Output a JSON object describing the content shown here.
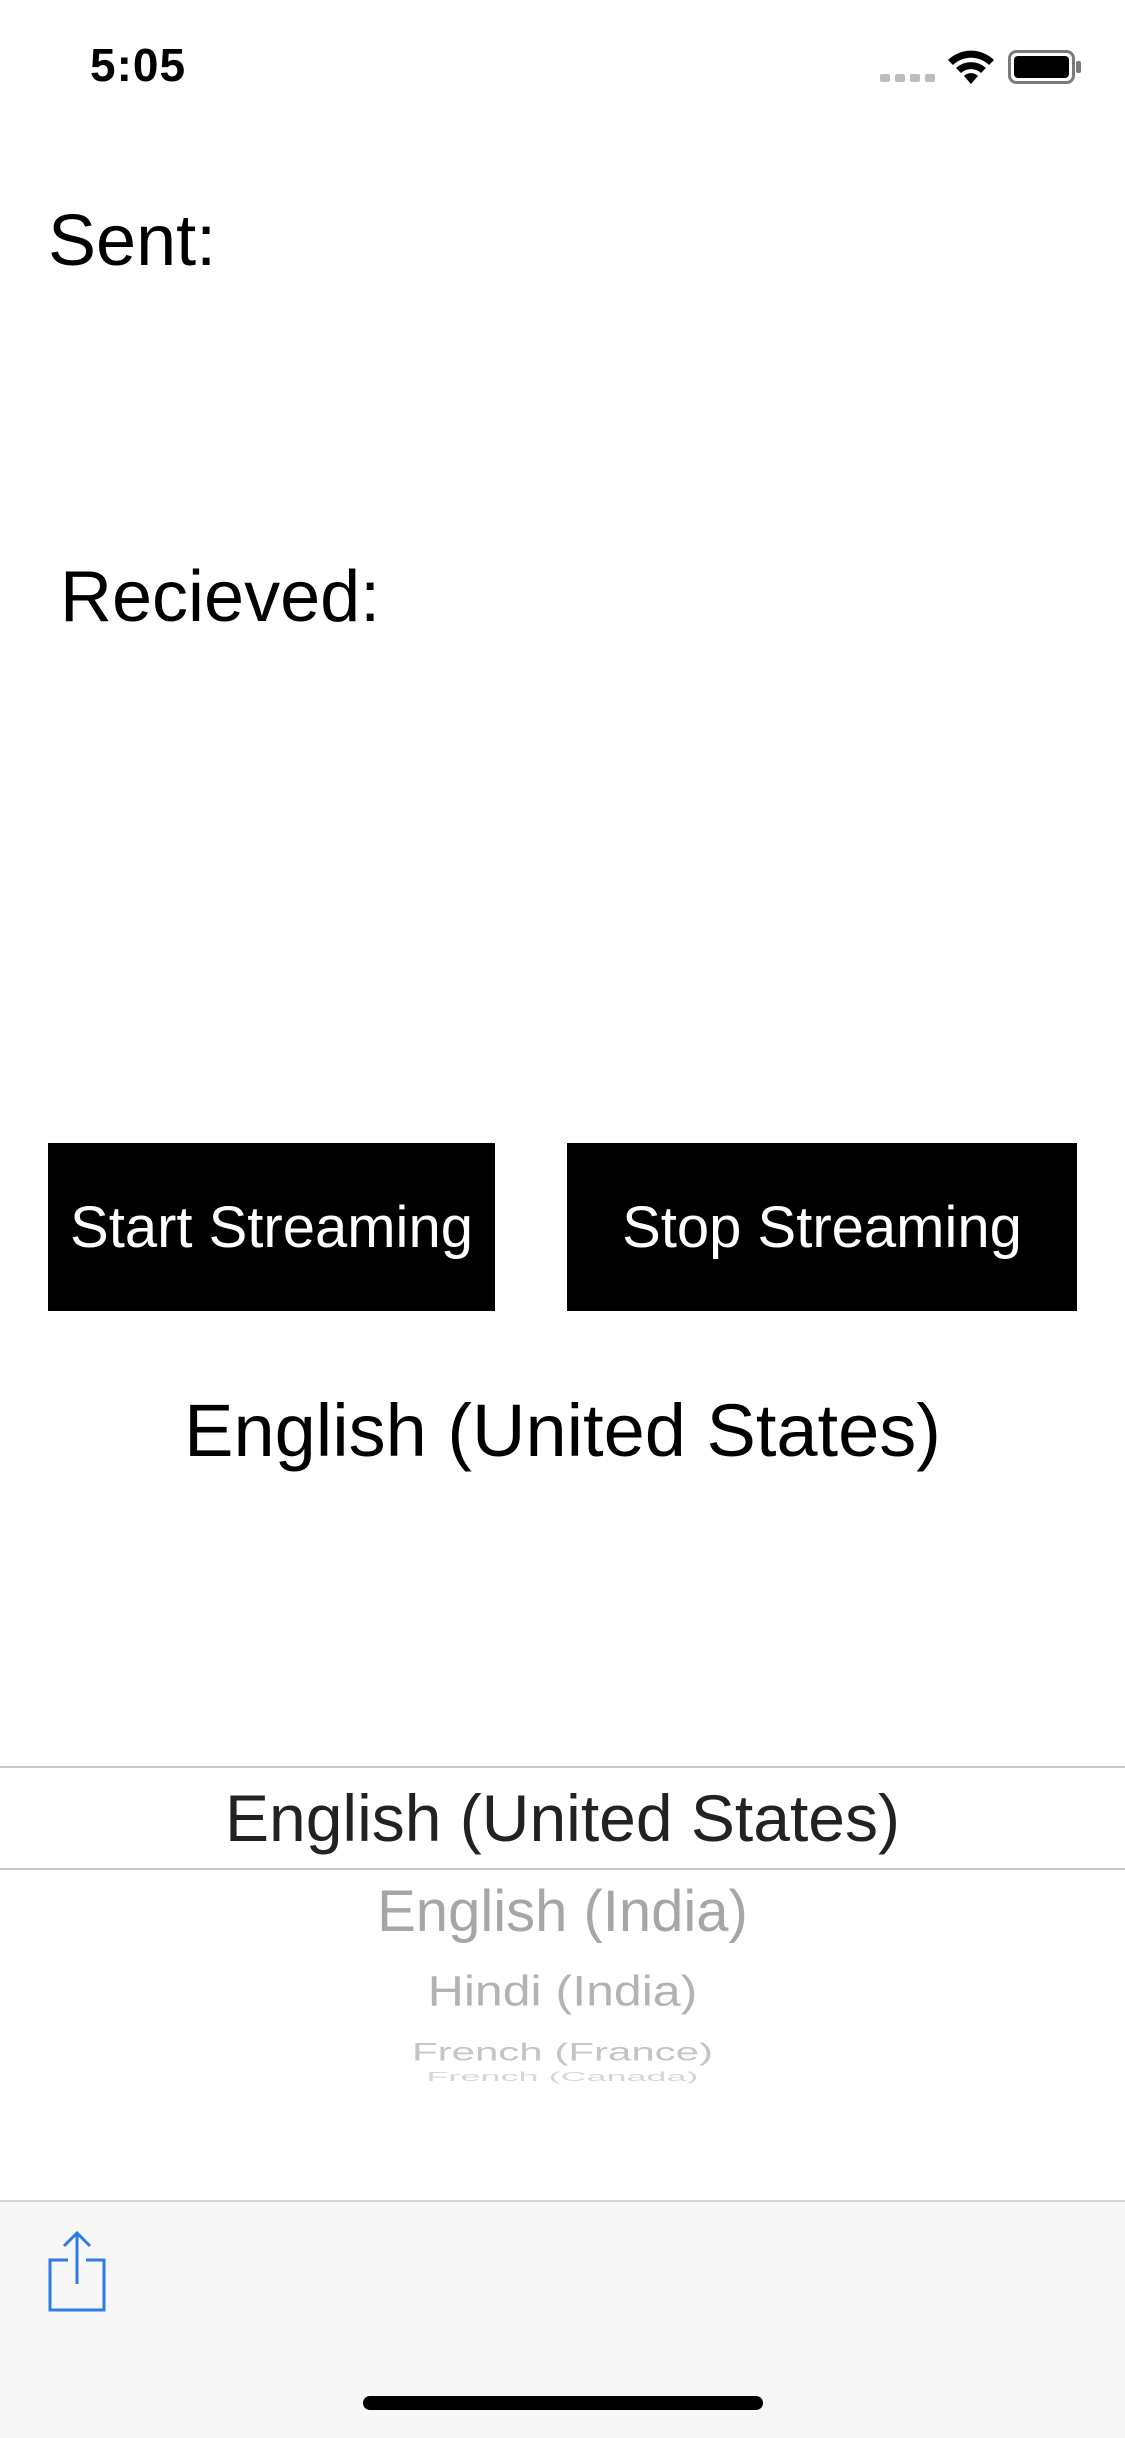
{
  "status_bar": {
    "time": "5:05",
    "icons": [
      "cellular-signal-icon",
      "wifi-icon",
      "battery-icon"
    ]
  },
  "labels": {
    "sent": "Sent:",
    "received": "Recieved:"
  },
  "buttons": {
    "start": "Start Streaming",
    "stop": "Stop Streaming"
  },
  "selected_language": "English (United States)",
  "picker": {
    "selected_index": 0,
    "items": [
      "English (United States)",
      "English (India)",
      "Hindi (India)",
      "French (France)",
      "French (Canada)"
    ]
  },
  "toolbar": {
    "icons": [
      "share-icon"
    ]
  },
  "colors": {
    "button_bg": "#000000",
    "button_text": "#ffffff",
    "toolbar_bg": "#f7f7f7",
    "accent": "#2f7ae5"
  }
}
